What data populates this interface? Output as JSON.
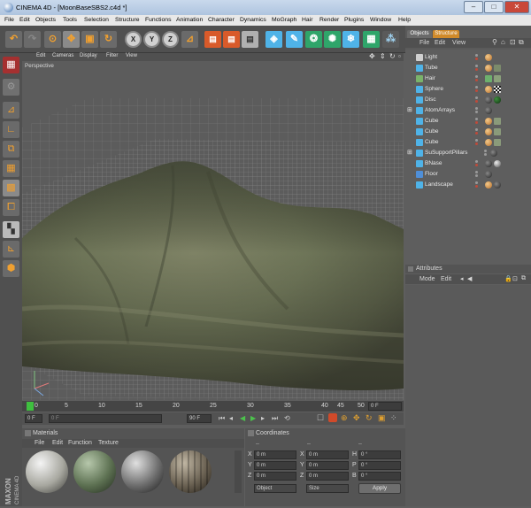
{
  "window": {
    "title": "CINEMA 4D - [MoonBaseSBS2.c4d *]",
    "minimize": "–",
    "maximize": "□",
    "close": "✕"
  },
  "menu": [
    "File",
    "Edit",
    "Objects",
    "Tools",
    "Selection",
    "Structure",
    "Functions",
    "Animation",
    "Character",
    "Dynamics",
    "MoGraph",
    "Hair",
    "Render",
    "Plugins",
    "Window",
    "Help"
  ],
  "toolbar": {
    "axis_x": "X",
    "axis_y": "Y",
    "axis_z": "Z"
  },
  "viewport": {
    "menu": [
      "Edit",
      "Cameras",
      "Display",
      "Filter",
      "View"
    ],
    "label": "Perspective"
  },
  "timeline": {
    "ticks": [
      "0",
      "5",
      "10",
      "15",
      "20",
      "25",
      "30",
      "35",
      "40",
      "45",
      "50"
    ],
    "current_frame": "0 F",
    "start_field": "0 F",
    "end_field": "90 F",
    "frame_field": "0 F"
  },
  "materials": {
    "title": "Materials",
    "menu": [
      "File",
      "Edit",
      "Function",
      "Texture"
    ]
  },
  "coordinates": {
    "title": "Coordinates",
    "col_headers": [
      "–",
      "–",
      "–"
    ],
    "rows": [
      {
        "a_label": "X",
        "a_val": "0 m",
        "b_label": "X",
        "b_val": "0 m",
        "c_label": "H",
        "c_val": "0 °"
      },
      {
        "a_label": "Y",
        "a_val": "0 m",
        "b_label": "Y",
        "b_val": "0 m",
        "c_label": "P",
        "c_val": "0 °"
      },
      {
        "a_label": "Z",
        "a_val": "0 m",
        "b_label": "Z",
        "b_val": "0 m",
        "c_label": "B",
        "c_val": "0 °"
      }
    ],
    "mode_select": "Object",
    "size_select": "Size",
    "apply": "Apply"
  },
  "objects_panel": {
    "tabs": [
      "Objects",
      "Structure"
    ],
    "menu": [
      "File",
      "Edit",
      "View"
    ],
    "items": [
      {
        "name": "Light",
        "color": "#e8e8e8"
      },
      {
        "name": "Tube",
        "color": "#4fb3e8"
      },
      {
        "name": "Hair",
        "color": "#7ab36a"
      },
      {
        "name": "Sphere",
        "color": "#4fb3e8"
      },
      {
        "name": "Disc",
        "color": "#4fb3e8"
      },
      {
        "name": "AtomArrays",
        "color": "#4fb3e8"
      },
      {
        "name": "Cube",
        "color": "#4fb3e8"
      },
      {
        "name": "Cube",
        "color": "#4fb3e8"
      },
      {
        "name": "Cube",
        "color": "#4fb3e8"
      },
      {
        "name": "SuSupportPillars",
        "color": "#4fb3e8"
      },
      {
        "name": "BNase",
        "color": "#4fb3e8"
      },
      {
        "name": "Floor",
        "color": "#4fb3e8"
      },
      {
        "name": "Landscape",
        "color": "#4fb3e8"
      }
    ]
  },
  "attributes": {
    "title": "Attributes",
    "menu": [
      "Mode",
      "Edit"
    ]
  },
  "branding": {
    "maxon": "MAXON",
    "product": "CINEMA 4D"
  }
}
